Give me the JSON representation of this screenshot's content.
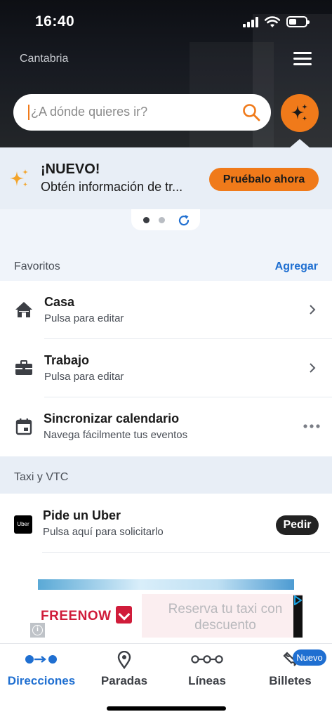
{
  "status_bar": {
    "time": "16:40"
  },
  "header": {
    "region": "Cantabria",
    "search_placeholder": "¿A dónde quieres ir?"
  },
  "promo": {
    "title": "¡NUEVO!",
    "subtitle": "Obtén información de tr...",
    "button": "Pruébalo ahora"
  },
  "favorites": {
    "header": "Favoritos",
    "action": "Agregar",
    "items": [
      {
        "title": "Casa",
        "subtitle": "Pulsa para editar",
        "icon": "home-icon"
      },
      {
        "title": "Trabajo",
        "subtitle": "Pulsa para editar",
        "icon": "briefcase-icon"
      },
      {
        "title": "Sincronizar calendario",
        "subtitle": "Navega fácilmente tus eventos",
        "icon": "calendar-icon"
      }
    ]
  },
  "taxi": {
    "header": "Taxi y VTC",
    "item": {
      "title": "Pide un Uber",
      "subtitle": "Pulsa aquí para solicitarlo",
      "logo": "Uber",
      "button": "Pedir"
    }
  },
  "ad": {
    "brand": "FREENOW",
    "copy": "Reserva tu taxi con descuento"
  },
  "tabs": [
    {
      "label": "Direcciones",
      "active": true
    },
    {
      "label": "Paradas",
      "active": false
    },
    {
      "label": "Líneas",
      "active": false
    },
    {
      "label": "Billetes",
      "active": false,
      "badge": "Nuevo"
    }
  ],
  "colors": {
    "accent": "#f07a1a",
    "link": "#1f6fd1",
    "header_bg": "#171a21"
  }
}
